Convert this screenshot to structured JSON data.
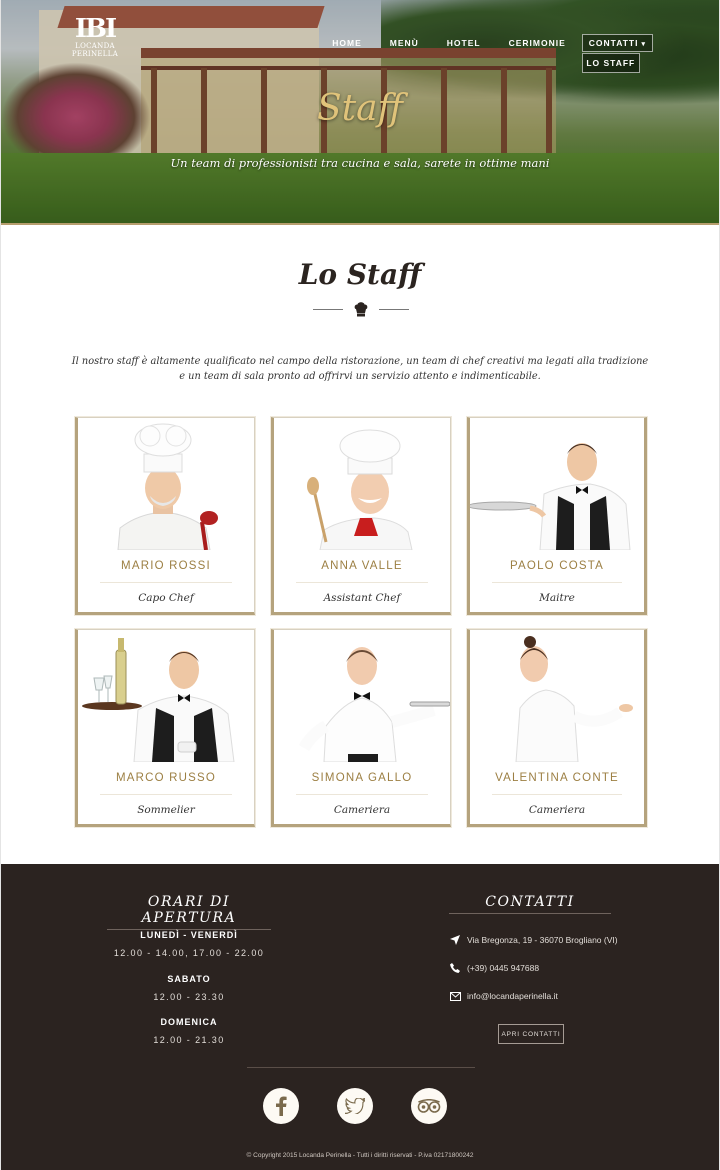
{
  "site": {
    "logo_text": "LOCANDA PERINELLA",
    "nav": [
      {
        "label": "HOME"
      },
      {
        "label": "MENÙ"
      },
      {
        "label": "HOTEL"
      },
      {
        "label": "CERIMONIE"
      },
      {
        "label": "CONTATTI"
      }
    ],
    "submenu": {
      "label": "LO STAFF"
    }
  },
  "hero": {
    "title": "Staff",
    "subtitle": "Un team di professionisti tra cucina e sala, sarete in ottime mani"
  },
  "section": {
    "title": "Lo Staff",
    "intro_line1": "Il nostro staff è altamente qualificato nel campo della ristorazione, un team di chef creativi ma legati alla tradizione",
    "intro_line2": "e un team di sala pronto ad offrirvi un servizio attento e indimenticabile."
  },
  "staff": [
    {
      "name": "MARIO ROSSI",
      "role": "Capo Chef"
    },
    {
      "name": "ANNA VALLE",
      "role": "Assistant Chef"
    },
    {
      "name": "PAOLO COSTA",
      "role": "Maitre"
    },
    {
      "name": "MARCO RUSSO",
      "role": "Sommelier"
    },
    {
      "name": "SIMONA GALLO",
      "role": "Cameriera"
    },
    {
      "name": "VALENTINA CONTE",
      "role": "Cameriera"
    }
  ],
  "footer": {
    "orari_title": "ORARI DI APERTURA",
    "schedule": [
      {
        "day": "LUNEDÌ - VENERDÌ",
        "hours": "12.00 - 14.00, 17.00 - 22.00"
      },
      {
        "day": "SABATO",
        "hours": "12.00 - 23.30"
      },
      {
        "day": "DOMENICA",
        "hours": "12.00 - 21.30"
      }
    ],
    "contatti_title": "CONTATTI",
    "address": "Via Bregonza, 19 - 36070 Brogliano (VI)",
    "phone": "(+39) 0445 947688",
    "email": "info@locandaperinella.it",
    "button": "APRI CONTATTI",
    "social": [
      "facebook-icon",
      "twitter-icon",
      "tripadvisor-icon"
    ],
    "copyright": "© Copyright 2015 Locanda Perinella - Tutti i diritti riservati - P.iva 02171800242"
  },
  "colors": {
    "gold": "#9c7f43",
    "footer_bg": "#2b2320",
    "hero_title": "#e0c37a"
  }
}
